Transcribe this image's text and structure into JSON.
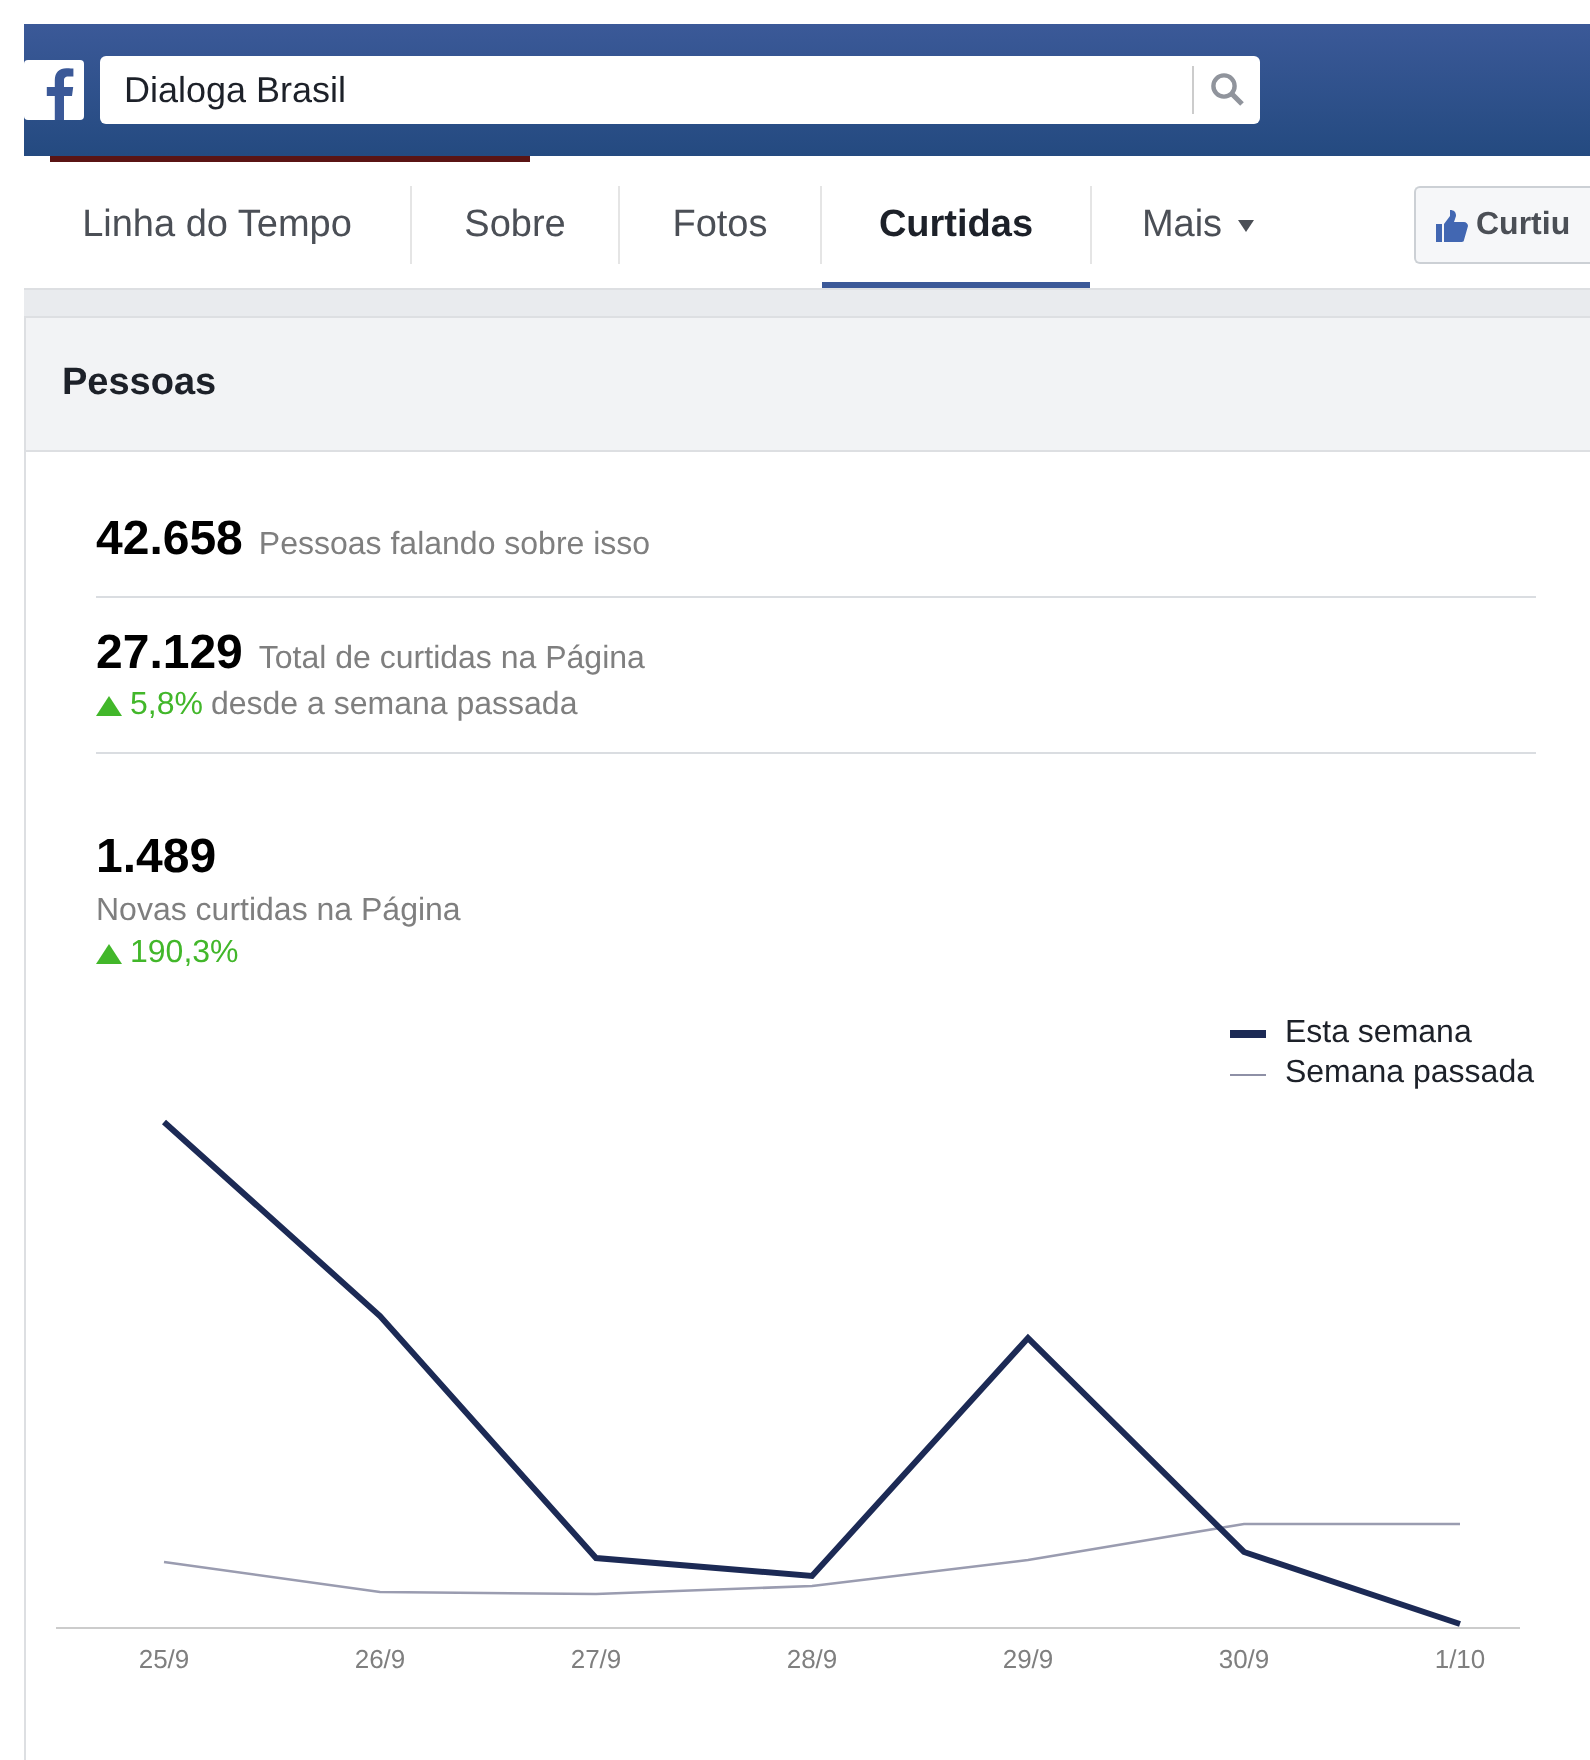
{
  "header": {
    "search": {
      "value": "Dialoga Brasil"
    }
  },
  "tabs": [
    {
      "label": "Linha do Tempo",
      "selected": false
    },
    {
      "label": "Sobre",
      "selected": false
    },
    {
      "label": "Fotos",
      "selected": false
    },
    {
      "label": "Curtidas",
      "selected": true
    },
    {
      "label": "Mais",
      "selected": false,
      "kind": "menu"
    }
  ],
  "like_button": {
    "label": "Curtiu"
  },
  "panel": {
    "title": "Pessoas",
    "stats": [
      {
        "kind": "inline",
        "value": "42.658",
        "label": "Pessoas falando sobre isso"
      },
      {
        "kind": "inline",
        "value": "27.129",
        "label": "Total de curtidas na Página",
        "change": {
          "value": "5,8%",
          "text": "desde a semana passada"
        }
      },
      {
        "kind": "stacked",
        "value": "1.489",
        "label": "Novas curtidas na Página",
        "change": {
          "value": "190,3%"
        }
      }
    ],
    "chart": {
      "legend": [
        {
          "label": "Esta semana",
          "kind": "this"
        },
        {
          "label": "Semana passada",
          "kind": "last"
        }
      ],
      "categories": [
        "25/9",
        "26/9",
        "27/9",
        "28/9",
        "29/9",
        "30/9",
        "1/10"
      ]
    }
  }
}
